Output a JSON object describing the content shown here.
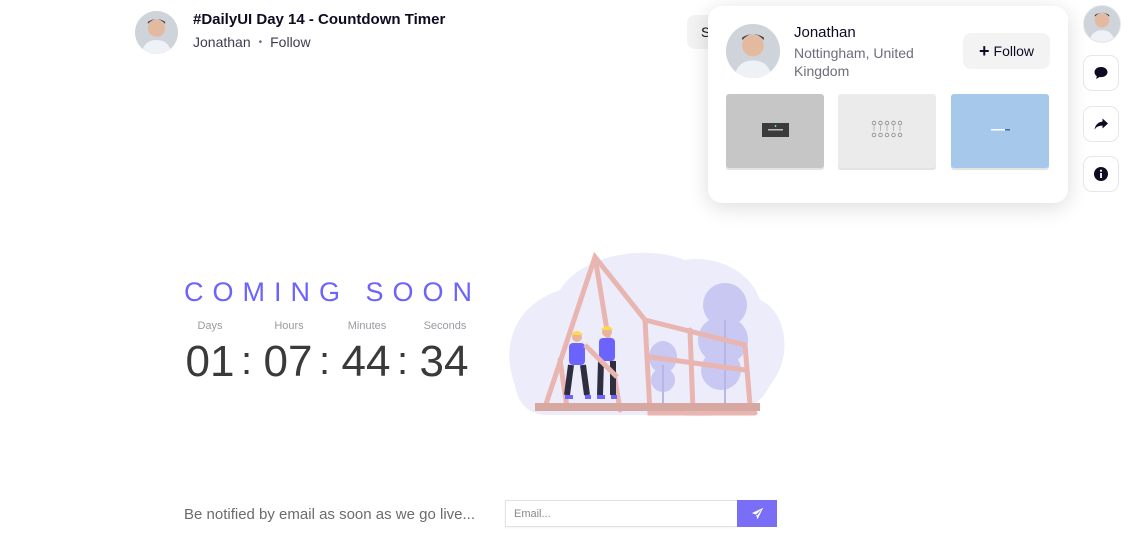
{
  "header": {
    "title": "#DailyUI Day 14 - Countdown Timer",
    "author": "Jonathan",
    "separator": "•",
    "follow_label": "Follow",
    "partial_button_label": "S"
  },
  "popover": {
    "name": "Jonathan",
    "location": "Nottingham, United Kingdom",
    "follow_label": "Follow",
    "follow_icon": "plus-icon",
    "thumbnails": [
      {
        "name": "shot-thumbnail-1",
        "color": "#c6c6c6"
      },
      {
        "name": "shot-thumbnail-2",
        "color": "#ebebeb"
      },
      {
        "name": "shot-thumbnail-3",
        "color": "#a6c8ea"
      }
    ]
  },
  "side_actions": [
    {
      "name": "comment-icon"
    },
    {
      "name": "share-icon"
    },
    {
      "name": "info-icon"
    }
  ],
  "shot": {
    "heading": "COMING SOON",
    "labels": {
      "days": "Days",
      "hours": "Hours",
      "minutes": "Minutes",
      "seconds": "Seconds"
    },
    "values": {
      "days": "01",
      "hours": "07",
      "minutes": "44",
      "seconds": "34"
    },
    "colon": ":",
    "notify_text": "Be notified by email as soon as we go live...",
    "email_placeholder": "Email...",
    "send_icon": "paper-plane-icon"
  },
  "colors": {
    "accent": "#6c63ff",
    "button_purple": "#7b6ef6",
    "text_dark": "#0d0c22",
    "counter_text": "#3a3a3a"
  }
}
